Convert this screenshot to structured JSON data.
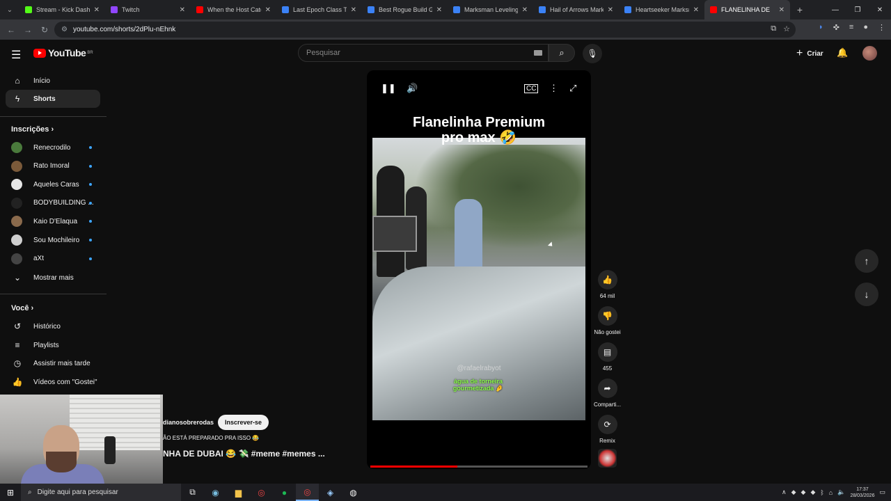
{
  "browser": {
    "tabs": [
      {
        "title": "Stream - Kick Dashbo",
        "color": "#53fc18"
      },
      {
        "title": "Twitch",
        "color": "#9146ff"
      },
      {
        "title": "When the Host Catch",
        "color": "#ff0000"
      },
      {
        "title": "Last Epoch Class Tier",
        "color": "#3b82f6"
      },
      {
        "title": "Best Rogue Build Gu",
        "color": "#3b82f6"
      },
      {
        "title": "Marksman Leveling G",
        "color": "#3b82f6"
      },
      {
        "title": "Hail of Arrows Marks",
        "color": "#3b82f6"
      },
      {
        "title": "Heartseeker Marksm",
        "color": "#3b82f6"
      },
      {
        "title": "FLANELINHA DE",
        "color": "#ff0000",
        "active": true
      }
    ],
    "url": "youtube.com/shorts/2dPlu-nEhnk"
  },
  "header": {
    "logo_text": "YouTube",
    "logo_region": "BR",
    "search_placeholder": "Pesquisar",
    "create_label": "Criar"
  },
  "sidebar": {
    "nav": [
      {
        "label": "Início",
        "icon": "home-icon"
      },
      {
        "label": "Shorts",
        "icon": "shorts-icon",
        "active": true
      }
    ],
    "subscriptions_title": "Inscrições",
    "subscriptions": [
      {
        "label": "Renecrodilo",
        "color": "#4a7a3c"
      },
      {
        "label": "Rato Imoral",
        "color": "#7b5a3a"
      },
      {
        "label": "Aqueles Caras",
        "color": "#e6e6e6"
      },
      {
        "label": "BODYBUILDING ...",
        "color": "#222222"
      },
      {
        "label": "Kaio D'Elaqua",
        "color": "#8a6a4c"
      },
      {
        "label": "Sou Mochileiro",
        "color": "#cfcfcf"
      },
      {
        "label": "aXt",
        "color": "#444444"
      }
    ],
    "show_more": "Mostrar mais",
    "you_title": "Você",
    "you_items": [
      {
        "label": "Histórico",
        "icon": "history-icon"
      },
      {
        "label": "Playlists",
        "icon": "playlist-icon"
      },
      {
        "label": "Assistir mais tarde",
        "icon": "watch-later-icon"
      },
      {
        "label": "Vídeos com \"Gostei\"",
        "icon": "thumbs-up-icon"
      }
    ]
  },
  "short": {
    "title_line1": "Flanelinha Premium",
    "title_line2": "pro max 🤣",
    "watermark": "@rafaelrabyot",
    "subtitle_line1": "água de torneira",
    "subtitle_line2": "gourmetizada 🤌",
    "channel": "dianosobrerodas",
    "subscribe_label": "Inscrever-se",
    "description_line1": "ÃO ESTÁ PREPARADO PRA ISSO 😂",
    "description_line2": "NHA DE DUBAI 😂 💸 #meme #memes ...",
    "progress_fraction": 0.4
  },
  "actions": {
    "likes": "64 mil",
    "dislike_label": "Não gostei",
    "comments": "455",
    "share_label": "Comparti...",
    "remix_label": "Remix"
  },
  "taskbar": {
    "search_placeholder": "Digite aqui para pesquisar",
    "time": "17:37",
    "date": "28/03/2026"
  }
}
